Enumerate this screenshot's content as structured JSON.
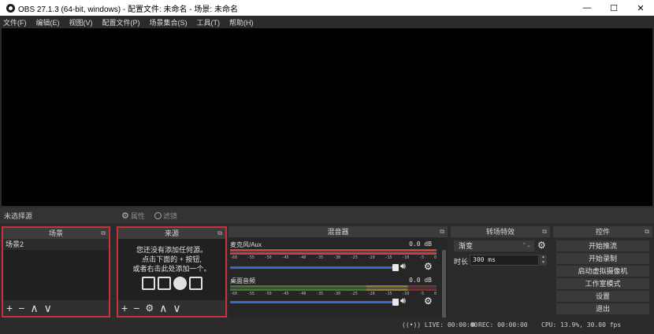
{
  "window": {
    "title": "OBS 27.1.3 (64-bit, windows) - 配置文件: 未命名 - 场景: 未命名",
    "min": "—",
    "max": "☐",
    "close": "✕"
  },
  "menu": [
    "文件(F)",
    "编辑(E)",
    "视图(V)",
    "配置文件(P)",
    "场景集合(S)",
    "工具(T)",
    "帮助(H)"
  ],
  "source_toolbar": {
    "no_source": "未选择源",
    "properties": "属性",
    "filters": "滤镜"
  },
  "scenes": {
    "header": "场景",
    "items": [
      "场景2"
    ]
  },
  "sources": {
    "header": "来源",
    "hint_line1": "您还没有添加任何源。",
    "hint_line2": "点击下面的 + 按钮,",
    "hint_line3": "或者右击此处添加一个。"
  },
  "mixer": {
    "header": "混音器",
    "channels": [
      {
        "name": "麦克风/Aux",
        "db": "0.0 dB"
      },
      {
        "name": "桌面音频",
        "db": "0.0 dB"
      }
    ],
    "ticks": [
      "-60",
      "-55",
      "-50",
      "-45",
      "-40",
      "-35",
      "-30",
      "-25",
      "-20",
      "-15",
      "-10",
      "-5",
      "0"
    ]
  },
  "transitions": {
    "header": "转场特效",
    "selected": "渐变",
    "duration_label": "时长",
    "duration_value": "300 ms"
  },
  "controls": {
    "header": "控件",
    "buttons": [
      "开始推流",
      "开始录制",
      "启动虚拟摄像机",
      "工作室模式",
      "设置",
      "退出"
    ]
  },
  "status": {
    "live": "LIVE: 00:00:00",
    "rec": "REC: 00:00:00",
    "cpu": "CPU: 13.9%, 30.00 fps"
  }
}
